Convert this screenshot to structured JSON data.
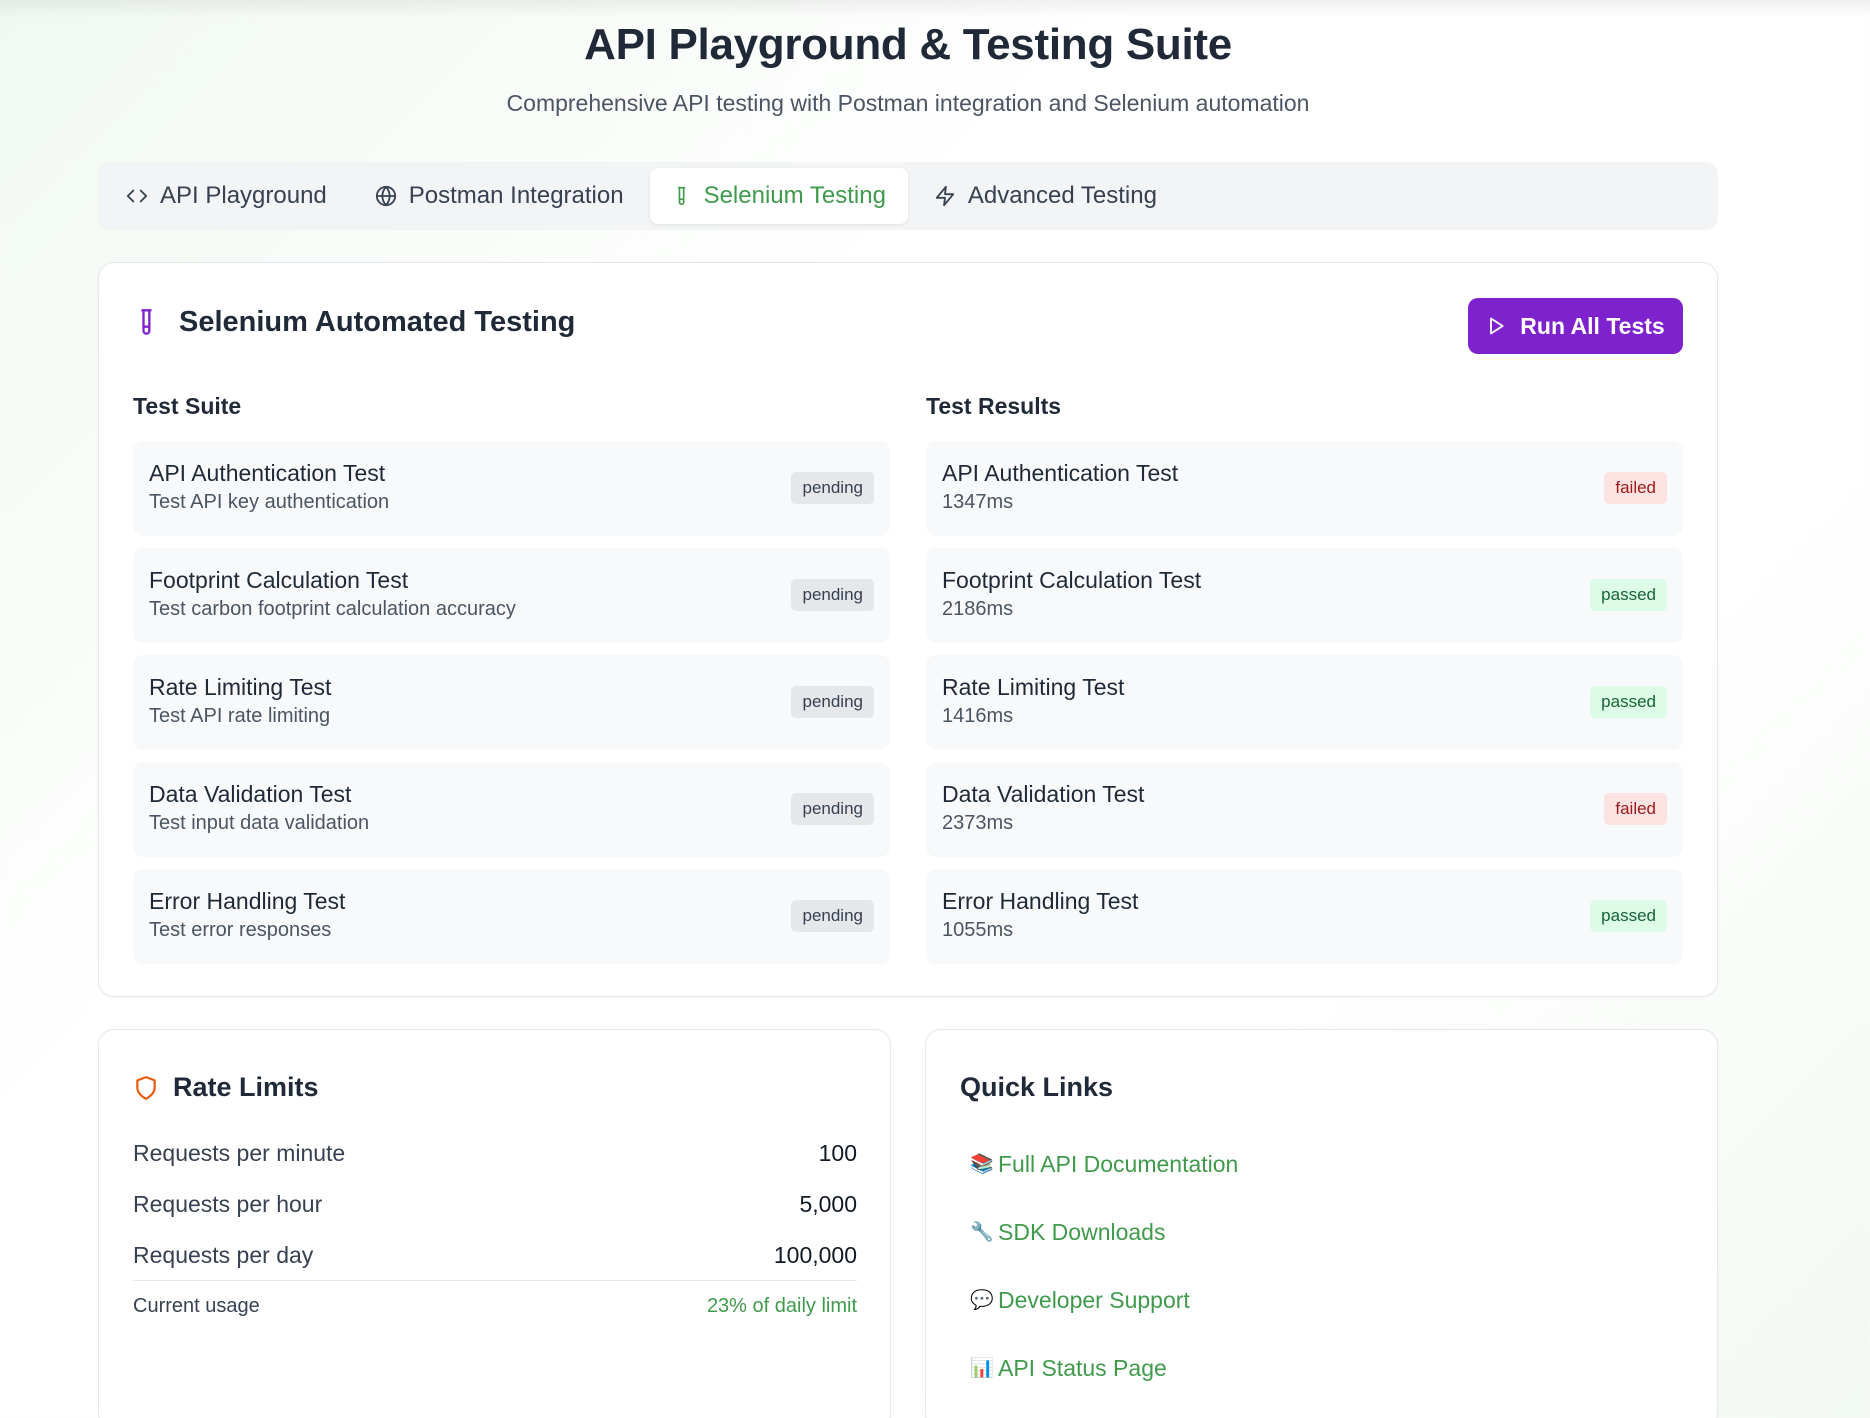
{
  "header": {
    "title": "API Playground & Testing Suite",
    "subtitle": "Comprehensive API testing with Postman integration and Selenium automation"
  },
  "tabs": [
    {
      "label": "API Playground",
      "icon": "code-icon",
      "active": false
    },
    {
      "label": "Postman Integration",
      "icon": "globe-icon",
      "active": false
    },
    {
      "label": "Selenium Testing",
      "icon": "test-tube-icon",
      "active": true
    },
    {
      "label": "Advanced Testing",
      "icon": "lightning-icon",
      "active": false
    }
  ],
  "selenium": {
    "title": "Selenium Automated Testing",
    "run_button": "Run All Tests",
    "suite_title": "Test Suite",
    "results_title": "Test Results",
    "suite": [
      {
        "name": "API Authentication Test",
        "description": "Test API key authentication",
        "status": "pending"
      },
      {
        "name": "Footprint Calculation Test",
        "description": "Test carbon footprint calculation accuracy",
        "status": "pending"
      },
      {
        "name": "Rate Limiting Test",
        "description": "Test API rate limiting",
        "status": "pending"
      },
      {
        "name": "Data Validation Test",
        "description": "Test input data validation",
        "status": "pending"
      },
      {
        "name": "Error Handling Test",
        "description": "Test error responses",
        "status": "pending"
      }
    ],
    "results": [
      {
        "name": "API Authentication Test",
        "duration": "1347ms",
        "status": "failed"
      },
      {
        "name": "Footprint Calculation Test",
        "duration": "2186ms",
        "status": "passed"
      },
      {
        "name": "Rate Limiting Test",
        "duration": "1416ms",
        "status": "passed"
      },
      {
        "name": "Data Validation Test",
        "duration": "2373ms",
        "status": "failed"
      },
      {
        "name": "Error Handling Test",
        "duration": "1055ms",
        "status": "passed"
      }
    ]
  },
  "rate_limits": {
    "title": "Rate Limits",
    "rows": [
      {
        "label": "Requests per minute",
        "value": "100"
      },
      {
        "label": "Requests per hour",
        "value": "5,000"
      },
      {
        "label": "Requests per day",
        "value": "100,000"
      }
    ],
    "usage_label": "Current usage",
    "usage_value": "23% of daily limit"
  },
  "quick_links": {
    "title": "Quick Links",
    "items": [
      {
        "emoji": "📚",
        "label": "Full API Documentation"
      },
      {
        "emoji": "🔧",
        "label": "SDK Downloads"
      },
      {
        "emoji": "💬",
        "label": "Developer Support"
      },
      {
        "emoji": "📊",
        "label": "API Status Page"
      }
    ]
  },
  "colors": {
    "accent_green": "#3f9a4b",
    "accent_purple": "#7e22ce",
    "warning_orange": "#ea580c"
  }
}
